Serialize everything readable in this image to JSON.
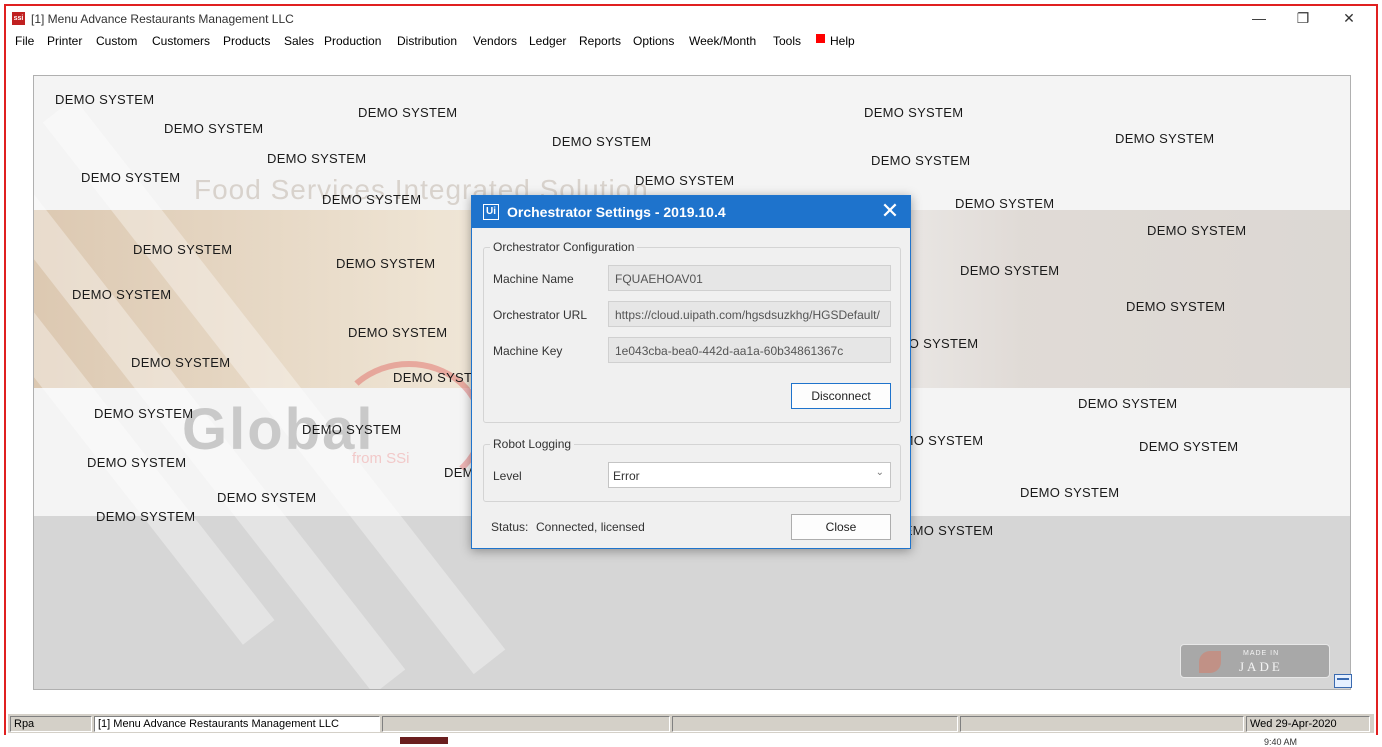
{
  "window": {
    "icon_text": "ssi",
    "title": "[1] Menu Advance Restaurants Management LLC",
    "minimize_glyph": "—",
    "maximize_glyph": "❐",
    "close_glyph": "✕"
  },
  "menu": [
    {
      "label": "File"
    },
    {
      "label": "Printer"
    },
    {
      "label": "Custom"
    },
    {
      "label": "Customers"
    },
    {
      "label": "Products"
    },
    {
      "label": "Sales"
    },
    {
      "label": "Production"
    },
    {
      "label": "Distribution"
    },
    {
      "label": "Vendors"
    },
    {
      "label": "Ledger"
    },
    {
      "label": "Reports"
    },
    {
      "label": "Options"
    },
    {
      "label": "Week/Month"
    },
    {
      "label": "Tools"
    },
    {
      "label": "Help"
    }
  ],
  "background": {
    "tagline": "Food Services Integrated Solution",
    "brand": "Global",
    "brand_sub": "from SSi",
    "watermark": "DEMO SYSTEM",
    "badge_made": "MADE IN",
    "badge_jade": "JADE"
  },
  "dialog": {
    "logo": "Ui",
    "title": "Orchestrator Settings - 2019.10.4",
    "close_glyph": "✕",
    "config_group": "Orchestrator Configuration",
    "machine_name_label": "Machine Name",
    "machine_name_value": "FQUAEHOAV01",
    "url_label": "Orchestrator URL",
    "url_value": "https://cloud.uipath.com/hgsdsuzkhg/HGSDefault/",
    "key_label": "Machine Key",
    "key_value": "1e043cba-bea0-442d-aa1a-60b34861367c",
    "disconnect_label": "Disconnect",
    "logging_group": "Robot Logging",
    "level_label": "Level",
    "level_value": "Error",
    "status_label": "Status:",
    "status_value": "Connected, licensed",
    "close_label": "Close"
  },
  "statusbar": {
    "user": "Rpa",
    "company": "[1] Menu Advance Restaurants Management LLC",
    "date": "Wed 29-Apr-2020"
  },
  "taskbar": {
    "clock": "9:40 AM"
  },
  "colors": {
    "accent": "#1e73cc",
    "frame_border": "#e02020",
    "help_marker": "#ff0000"
  }
}
